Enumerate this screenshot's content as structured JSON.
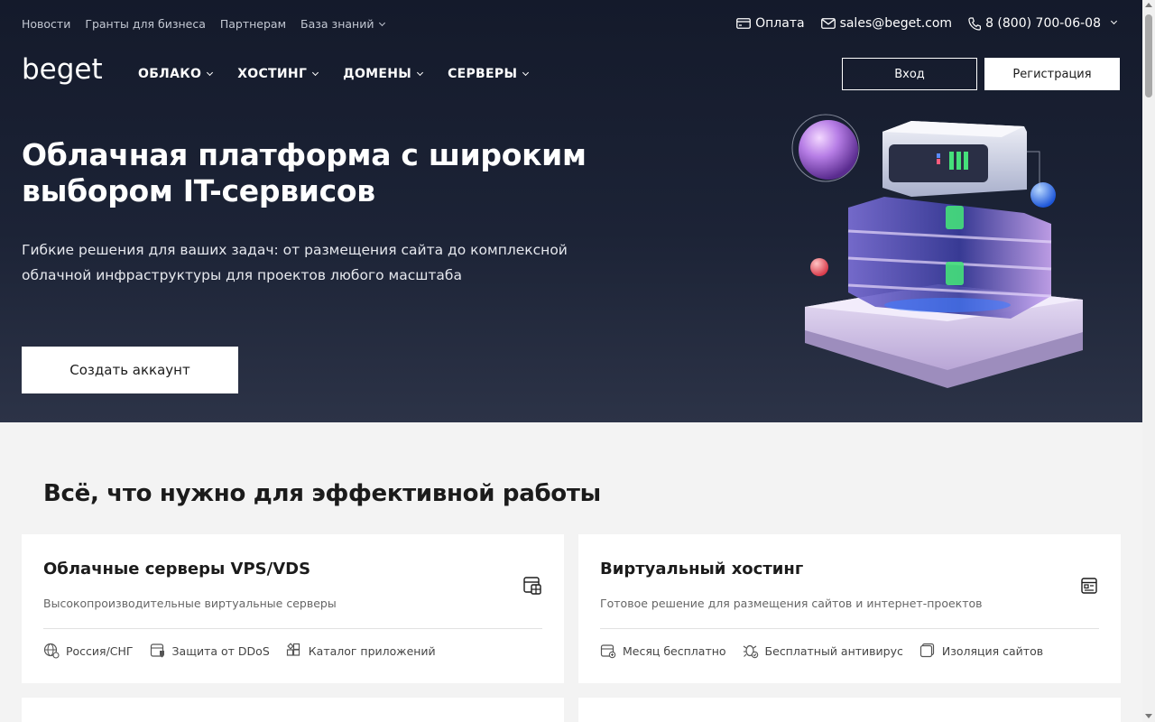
{
  "topbar": {
    "links": [
      "Новости",
      "Гранты для бизнеса",
      "Партнерам",
      "База знаний"
    ]
  },
  "contacts": {
    "payment": "Оплата",
    "email": "sales@beget.com",
    "phone": "8 (800) 700-06-08"
  },
  "logo": {
    "text": "beget"
  },
  "nav": {
    "items": [
      "ОБЛАКО",
      "ХОСТИНГ",
      "ДОМЕНЫ",
      "СЕРВЕРЫ"
    ]
  },
  "auth": {
    "login": "Вход",
    "register": "Регистрация"
  },
  "hero": {
    "title_line1": "Облачная платформа с широким",
    "title_line2": "выбором IT-сервисов",
    "subtitle_line1": "Гибкие решения для ваших задач: от размещения сайта до комплексной",
    "subtitle_line2": "облачной инфраструктуры для проектов любого масштаба",
    "cta": "Создать аккаунт"
  },
  "section": {
    "title": "Всё, что нужно для эффективной работы"
  },
  "cards": [
    {
      "title": "Облачные серверы VPS/VDS",
      "description": "Высокопроизводительные виртуальные серверы",
      "icon": "vps-server-icon",
      "features": [
        "Россия/СНГ",
        "Защита от DDoS",
        "Каталог приложений"
      ]
    },
    {
      "title": "Виртуальный хостинг",
      "description": "Готовое решение для размещения сайтов и интернет-проектов",
      "icon": "hosting-panel-icon",
      "features": [
        "Месяц бесплатно",
        "Бесплатный антивирус",
        "Изоляция сайтов"
      ]
    }
  ],
  "colors": {
    "hero_bg_top": "#141a2b",
    "hero_bg_bottom": "#2c3347",
    "page_bg": "#f3f3f3",
    "card_bg": "#ffffff",
    "text_dark": "#1b1b1b",
    "accent_purple": "#b98ae8",
    "accent_green": "#45e07a"
  }
}
